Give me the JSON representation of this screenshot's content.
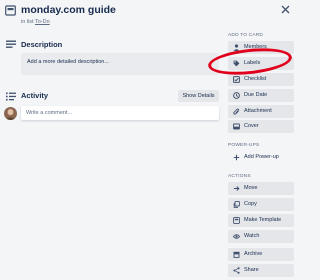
{
  "card": {
    "title": "monday.com guide",
    "list_prefix": "in list",
    "list_name": "To-Do"
  },
  "description": {
    "heading": "Description",
    "placeholder": "Add a more detailed description..."
  },
  "activity": {
    "heading": "Activity",
    "show_details": "Show Details",
    "comment_placeholder": "Write a comment..."
  },
  "sidebar": {
    "add_to_card_heading": "ADD TO CARD",
    "add_to_card": [
      {
        "label": "Members",
        "icon": "person-icon"
      },
      {
        "label": "Labels",
        "icon": "tag-icon"
      },
      {
        "label": "Checklist",
        "icon": "checkbox-icon"
      },
      {
        "label": "Due Date",
        "icon": "clock-icon"
      },
      {
        "label": "Attachment",
        "icon": "paperclip-icon"
      },
      {
        "label": "Cover",
        "icon": "image-icon"
      }
    ],
    "power_ups_heading": "POWER-UPS",
    "add_power_up": "Add Power-up",
    "actions_heading": "ACTIONS",
    "actions": [
      {
        "label": "Move",
        "icon": "arrow-right-icon"
      },
      {
        "label": "Copy",
        "icon": "copy-icon"
      },
      {
        "label": "Make Template",
        "icon": "template-icon"
      },
      {
        "label": "Watch",
        "icon": "eye-icon"
      },
      {
        "label": "Archive",
        "icon": "archive-icon"
      },
      {
        "label": "Share",
        "icon": "share-icon"
      }
    ]
  },
  "colors": {
    "background": "#f4f5f7",
    "button": "#e4e6ea",
    "highlight": "#e0001b",
    "text": "#172b4d"
  }
}
